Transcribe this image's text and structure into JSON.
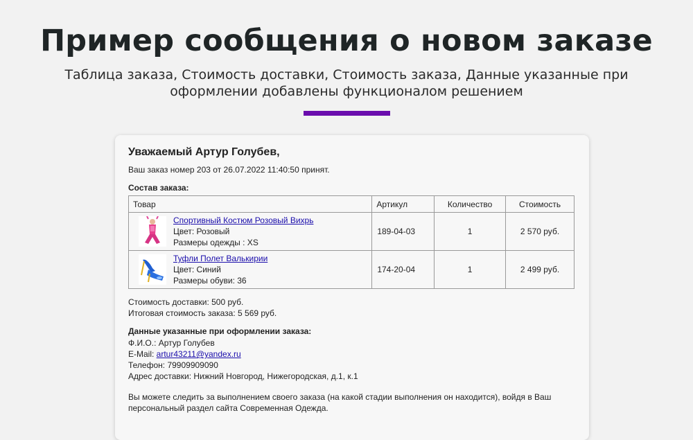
{
  "hero": {
    "title": "Пример сообщения о новом заказе",
    "subtitle": "Таблица заказа, Стоимость доставки, Стоимость заказа, Данные указанные при оформлении добавлены функционалом решением",
    "accent_color": "#6a0dad"
  },
  "email": {
    "greeting": "Уважаемый Артур Голубев,",
    "order_accepted": "Ваш заказ номер 203 от 26.07.2022 11:40:50 принят.",
    "order_contents_title": "Состав заказа:",
    "table": {
      "headers": {
        "product": "Товар",
        "article": "Артикул",
        "quantity": "Количество",
        "price": "Стоимость"
      },
      "rows": [
        {
          "name": "Спортивный Костюм Розовый Вихрь",
          "line1": "Цвет: Розовый",
          "line2": "Размеры одежды : XS",
          "article": "189-04-03",
          "quantity": "1",
          "price": "2 570 руб.",
          "thumb_icon": "pink-tracksuit-figure-icon"
        },
        {
          "name": "Туфли Полет Валькирии",
          "line1": "Цвет: Синий",
          "line2": "Размеры обуви: 36",
          "article": "174-20-04",
          "quantity": "1",
          "price": "2 499 руб.",
          "thumb_icon": "blue-shoes-icon"
        }
      ]
    },
    "delivery_cost": "Стоимость доставки: 500 руб.",
    "total_cost": "Итоговая стоимость заказа: 5 569 руб.",
    "details_title": "Данные указанные при оформлении заказа:",
    "fio": "Ф.И.О.: Артур Голубев",
    "email_label": "E-Mail: ",
    "email_value": "artur43211@yandex.ru",
    "phone": "Телефон: 79909909090",
    "address": "Адрес доставки: Нижний Новгород, Нижегородская, д.1, к.1",
    "footer": "Вы можете следить за выполнением своего заказа (на какой стадии выполнения он находится), войдя в Ваш персональный раздел сайта Современная Одежда."
  }
}
